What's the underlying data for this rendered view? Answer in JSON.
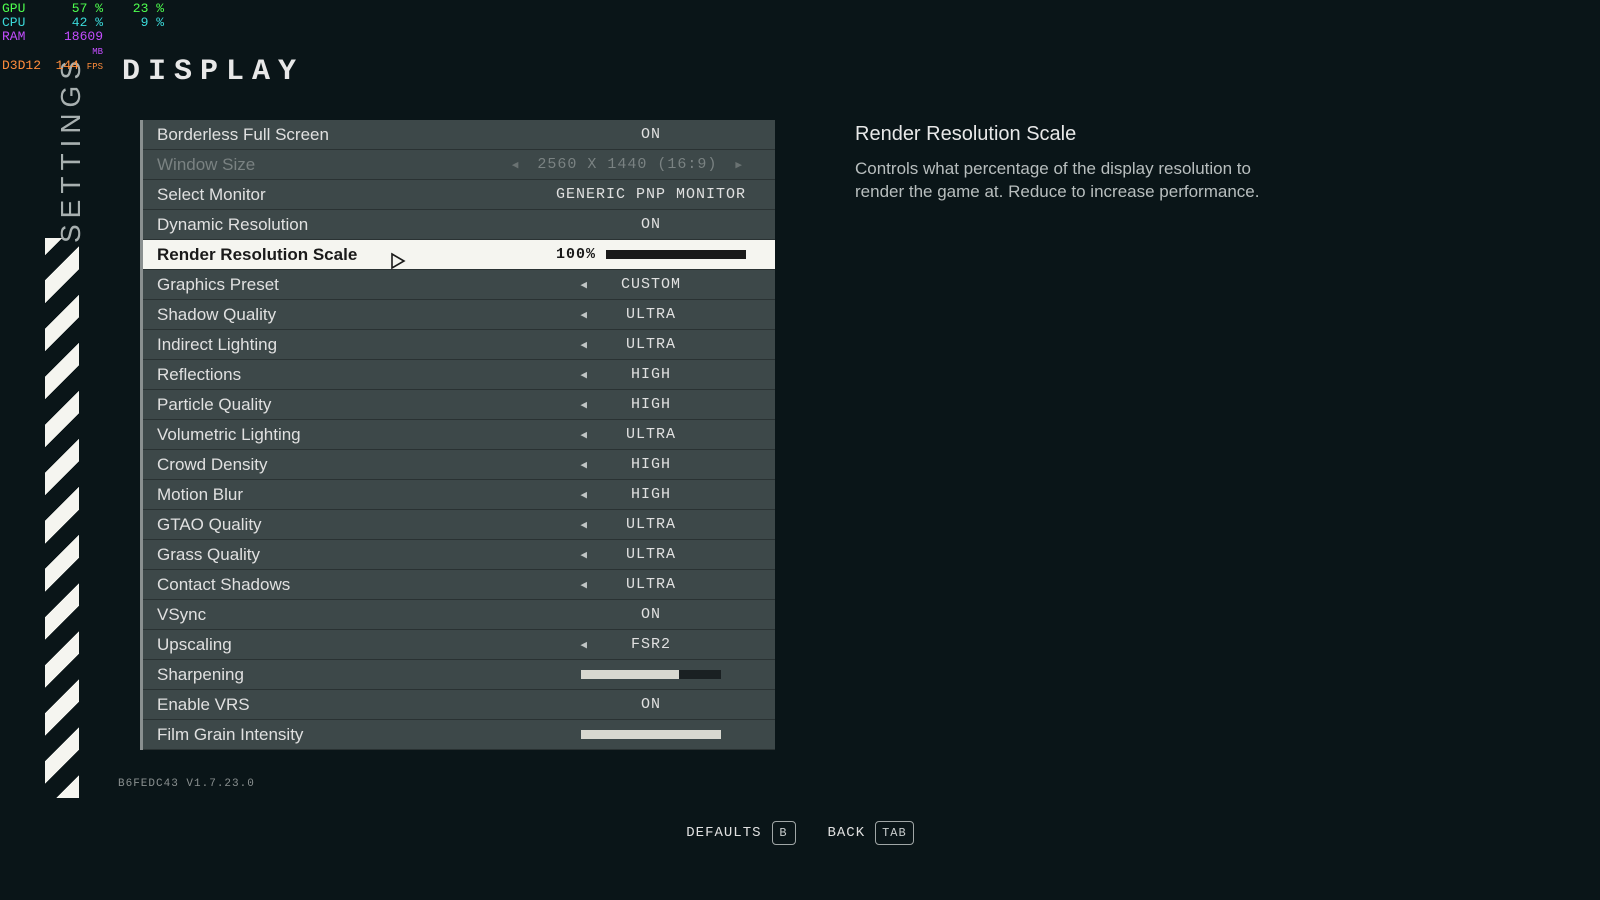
{
  "perf": {
    "gpu_label": "GPU",
    "gpu_pct": "57",
    "gpu_temp": "23",
    "cpu_label": "CPU",
    "cpu_pct": "42",
    "cpu_temp": "9",
    "ram_label": "RAM",
    "ram_val": "18609",
    "d3d_label": "D3D12",
    "fps": "144"
  },
  "vertical_label": "SETTINGS",
  "page_title": "DISPLAY",
  "settings": [
    {
      "label": "Borderless Full Screen",
      "value": "ON",
      "type": "toggle"
    },
    {
      "label": "Window Size",
      "value": "2560 X 1440 (16:9)",
      "type": "picker",
      "disabled": true
    },
    {
      "label": "Select Monitor",
      "value": "GENERIC PNP MONITOR",
      "type": "text"
    },
    {
      "label": "Dynamic Resolution",
      "value": "ON",
      "type": "toggle"
    },
    {
      "label": "Render Resolution Scale",
      "value": "100%",
      "type": "slider",
      "fill": 100,
      "selected": true
    },
    {
      "label": "Graphics Preset",
      "value": "CUSTOM",
      "type": "picker_left"
    },
    {
      "label": "Shadow Quality",
      "value": "ULTRA",
      "type": "picker_left"
    },
    {
      "label": "Indirect Lighting",
      "value": "ULTRA",
      "type": "picker_left"
    },
    {
      "label": "Reflections",
      "value": "HIGH",
      "type": "picker_left"
    },
    {
      "label": "Particle Quality",
      "value": "HIGH",
      "type": "picker_left"
    },
    {
      "label": "Volumetric Lighting",
      "value": "ULTRA",
      "type": "picker_left"
    },
    {
      "label": "Crowd Density",
      "value": "HIGH",
      "type": "picker_left"
    },
    {
      "label": "Motion Blur",
      "value": "HIGH",
      "type": "picker_left"
    },
    {
      "label": "GTAO Quality",
      "value": "ULTRA",
      "type": "picker_left"
    },
    {
      "label": "Grass Quality",
      "value": "ULTRA",
      "type": "picker_left"
    },
    {
      "label": "Contact Shadows",
      "value": "ULTRA",
      "type": "picker_left"
    },
    {
      "label": "VSync",
      "value": "ON",
      "type": "toggle"
    },
    {
      "label": "Upscaling",
      "value": "FSR2",
      "type": "picker_left"
    },
    {
      "label": "Sharpening",
      "value": "",
      "type": "slider_only",
      "fill": 70
    },
    {
      "label": "Enable VRS",
      "value": "ON",
      "type": "toggle"
    },
    {
      "label": "Film Grain Intensity",
      "value": "",
      "type": "slider_only",
      "fill": 100
    }
  ],
  "description": {
    "title": "Render Resolution Scale",
    "body": "Controls what percentage of the display resolution to render the game at. Reduce to increase performance."
  },
  "version": "B6FEDC43 V1.7.23.0",
  "footer": {
    "defaults_label": "DEFAULTS",
    "defaults_key": "B",
    "back_label": "BACK",
    "back_key": "TAB"
  }
}
